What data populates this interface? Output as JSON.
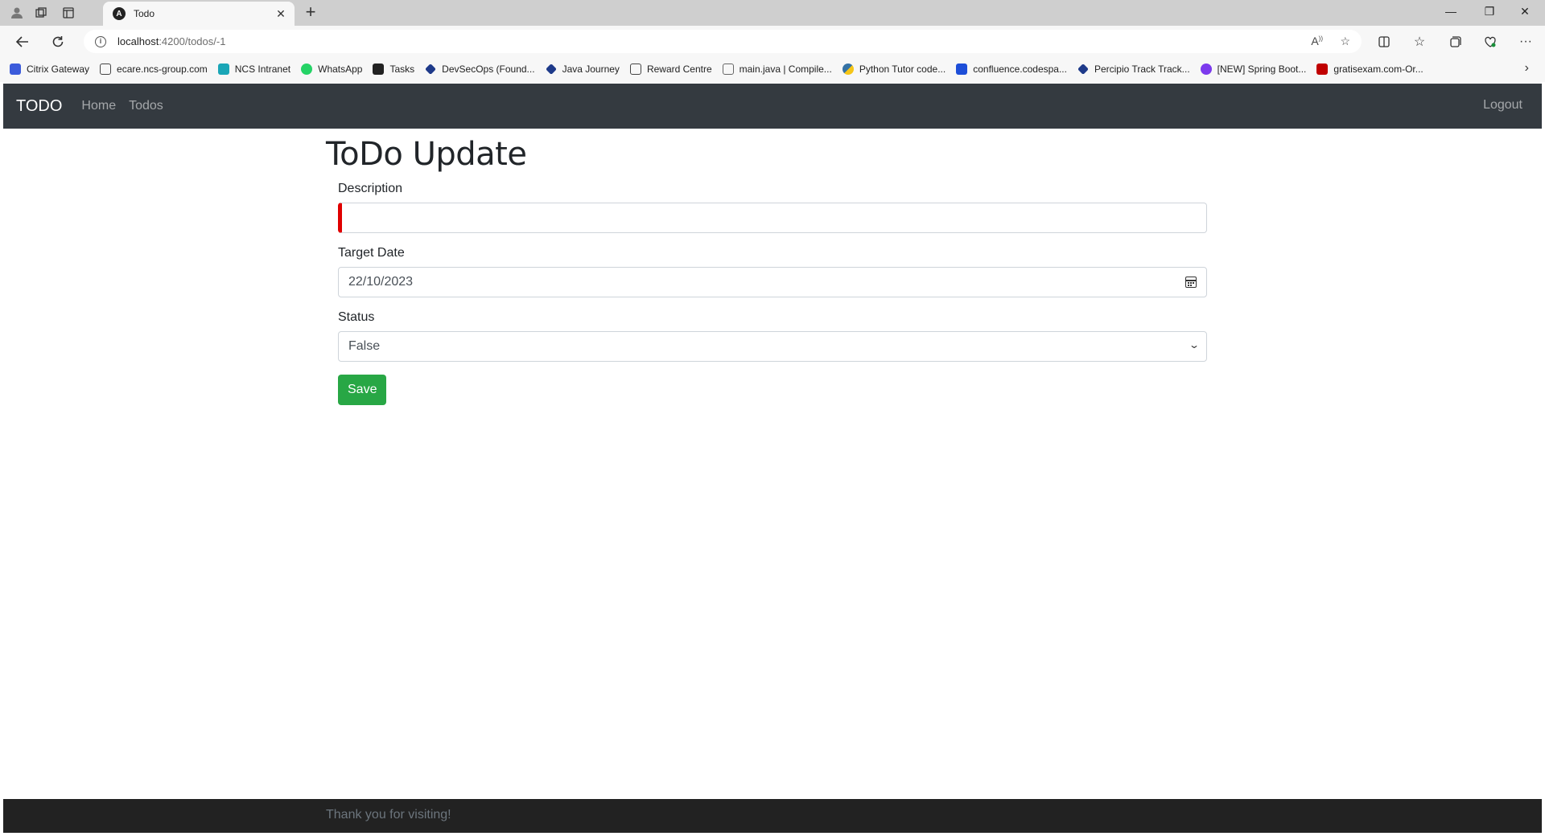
{
  "browser": {
    "tab_title": "Todo",
    "tab_favicon": "A",
    "url_host": "localhost",
    "url_path": ":4200/todos/-1",
    "bookmarks": [
      {
        "label": "Citrix Gateway",
        "color": "#3b5bdb"
      },
      {
        "label": "ecare.ncs-group.com",
        "color": "#ffffff"
      },
      {
        "label": "NCS Intranet",
        "color": "#1aa6b7"
      },
      {
        "label": "WhatsApp",
        "color": "#25d366"
      },
      {
        "label": "Tasks",
        "color": "#222222"
      },
      {
        "label": "DevSecOps (Found...",
        "color": "#1e3a8a"
      },
      {
        "label": "Java Journey",
        "color": "#1e3a8a"
      },
      {
        "label": "Reward Centre",
        "color": "#ffffff"
      },
      {
        "label": "main.java | Compile...",
        "color": "#666666"
      },
      {
        "label": "Python Tutor code...",
        "color": "#f5c518"
      },
      {
        "label": "confluence.codespa...",
        "color": "#1d4ed8"
      },
      {
        "label": "Percipio Track Track...",
        "color": "#1e3a8a"
      },
      {
        "label": "[NEW] Spring Boot...",
        "color": "#7c3aed"
      },
      {
        "label": "gratisexam.com-Or...",
        "color": "#c00000"
      }
    ]
  },
  "navbar": {
    "brand": "TODO",
    "links": [
      "Home",
      "Todos"
    ],
    "logout": "Logout"
  },
  "main": {
    "title": "ToDo Update",
    "description_label": "Description",
    "description_value": "",
    "target_date_label": "Target Date",
    "target_date_value": "22/10/2023",
    "status_label": "Status",
    "status_value": "False",
    "save_label": "Save"
  },
  "footer": {
    "text": "Thank you for visiting!"
  }
}
